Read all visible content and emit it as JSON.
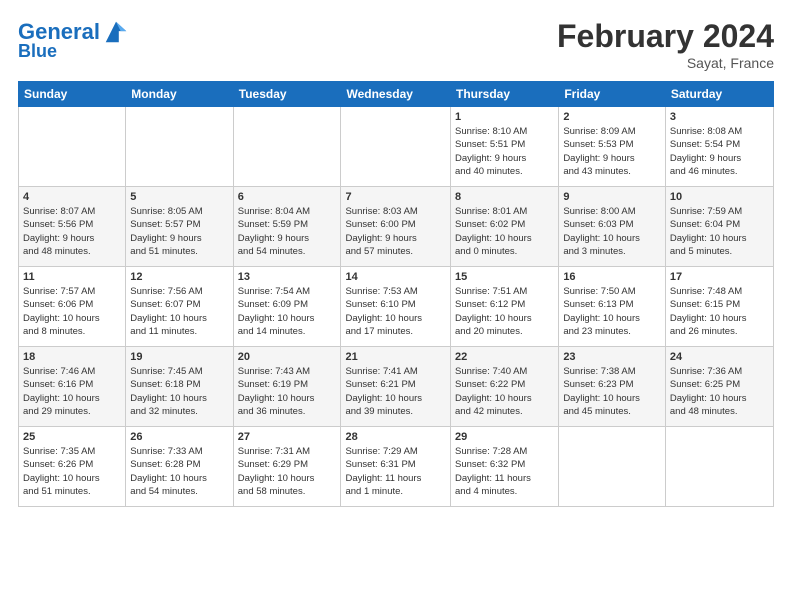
{
  "header": {
    "logo_line1": "General",
    "logo_line2": "Blue",
    "title": "February 2024",
    "subtitle": "Sayat, France"
  },
  "weekdays": [
    "Sunday",
    "Monday",
    "Tuesday",
    "Wednesday",
    "Thursday",
    "Friday",
    "Saturday"
  ],
  "weeks": [
    [
      {
        "day": "",
        "info": ""
      },
      {
        "day": "",
        "info": ""
      },
      {
        "day": "",
        "info": ""
      },
      {
        "day": "",
        "info": ""
      },
      {
        "day": "1",
        "info": "Sunrise: 8:10 AM\nSunset: 5:51 PM\nDaylight: 9 hours\nand 40 minutes."
      },
      {
        "day": "2",
        "info": "Sunrise: 8:09 AM\nSunset: 5:53 PM\nDaylight: 9 hours\nand 43 minutes."
      },
      {
        "day": "3",
        "info": "Sunrise: 8:08 AM\nSunset: 5:54 PM\nDaylight: 9 hours\nand 46 minutes."
      }
    ],
    [
      {
        "day": "4",
        "info": "Sunrise: 8:07 AM\nSunset: 5:56 PM\nDaylight: 9 hours\nand 48 minutes."
      },
      {
        "day": "5",
        "info": "Sunrise: 8:05 AM\nSunset: 5:57 PM\nDaylight: 9 hours\nand 51 minutes."
      },
      {
        "day": "6",
        "info": "Sunrise: 8:04 AM\nSunset: 5:59 PM\nDaylight: 9 hours\nand 54 minutes."
      },
      {
        "day": "7",
        "info": "Sunrise: 8:03 AM\nSunset: 6:00 PM\nDaylight: 9 hours\nand 57 minutes."
      },
      {
        "day": "8",
        "info": "Sunrise: 8:01 AM\nSunset: 6:02 PM\nDaylight: 10 hours\nand 0 minutes."
      },
      {
        "day": "9",
        "info": "Sunrise: 8:00 AM\nSunset: 6:03 PM\nDaylight: 10 hours\nand 3 minutes."
      },
      {
        "day": "10",
        "info": "Sunrise: 7:59 AM\nSunset: 6:04 PM\nDaylight: 10 hours\nand 5 minutes."
      }
    ],
    [
      {
        "day": "11",
        "info": "Sunrise: 7:57 AM\nSunset: 6:06 PM\nDaylight: 10 hours\nand 8 minutes."
      },
      {
        "day": "12",
        "info": "Sunrise: 7:56 AM\nSunset: 6:07 PM\nDaylight: 10 hours\nand 11 minutes."
      },
      {
        "day": "13",
        "info": "Sunrise: 7:54 AM\nSunset: 6:09 PM\nDaylight: 10 hours\nand 14 minutes."
      },
      {
        "day": "14",
        "info": "Sunrise: 7:53 AM\nSunset: 6:10 PM\nDaylight: 10 hours\nand 17 minutes."
      },
      {
        "day": "15",
        "info": "Sunrise: 7:51 AM\nSunset: 6:12 PM\nDaylight: 10 hours\nand 20 minutes."
      },
      {
        "day": "16",
        "info": "Sunrise: 7:50 AM\nSunset: 6:13 PM\nDaylight: 10 hours\nand 23 minutes."
      },
      {
        "day": "17",
        "info": "Sunrise: 7:48 AM\nSunset: 6:15 PM\nDaylight: 10 hours\nand 26 minutes."
      }
    ],
    [
      {
        "day": "18",
        "info": "Sunrise: 7:46 AM\nSunset: 6:16 PM\nDaylight: 10 hours\nand 29 minutes."
      },
      {
        "day": "19",
        "info": "Sunrise: 7:45 AM\nSunset: 6:18 PM\nDaylight: 10 hours\nand 32 minutes."
      },
      {
        "day": "20",
        "info": "Sunrise: 7:43 AM\nSunset: 6:19 PM\nDaylight: 10 hours\nand 36 minutes."
      },
      {
        "day": "21",
        "info": "Sunrise: 7:41 AM\nSunset: 6:21 PM\nDaylight: 10 hours\nand 39 minutes."
      },
      {
        "day": "22",
        "info": "Sunrise: 7:40 AM\nSunset: 6:22 PM\nDaylight: 10 hours\nand 42 minutes."
      },
      {
        "day": "23",
        "info": "Sunrise: 7:38 AM\nSunset: 6:23 PM\nDaylight: 10 hours\nand 45 minutes."
      },
      {
        "day": "24",
        "info": "Sunrise: 7:36 AM\nSunset: 6:25 PM\nDaylight: 10 hours\nand 48 minutes."
      }
    ],
    [
      {
        "day": "25",
        "info": "Sunrise: 7:35 AM\nSunset: 6:26 PM\nDaylight: 10 hours\nand 51 minutes."
      },
      {
        "day": "26",
        "info": "Sunrise: 7:33 AM\nSunset: 6:28 PM\nDaylight: 10 hours\nand 54 minutes."
      },
      {
        "day": "27",
        "info": "Sunrise: 7:31 AM\nSunset: 6:29 PM\nDaylight: 10 hours\nand 58 minutes."
      },
      {
        "day": "28",
        "info": "Sunrise: 7:29 AM\nSunset: 6:31 PM\nDaylight: 11 hours\nand 1 minute."
      },
      {
        "day": "29",
        "info": "Sunrise: 7:28 AM\nSunset: 6:32 PM\nDaylight: 11 hours\nand 4 minutes."
      },
      {
        "day": "",
        "info": ""
      },
      {
        "day": "",
        "info": ""
      }
    ]
  ]
}
